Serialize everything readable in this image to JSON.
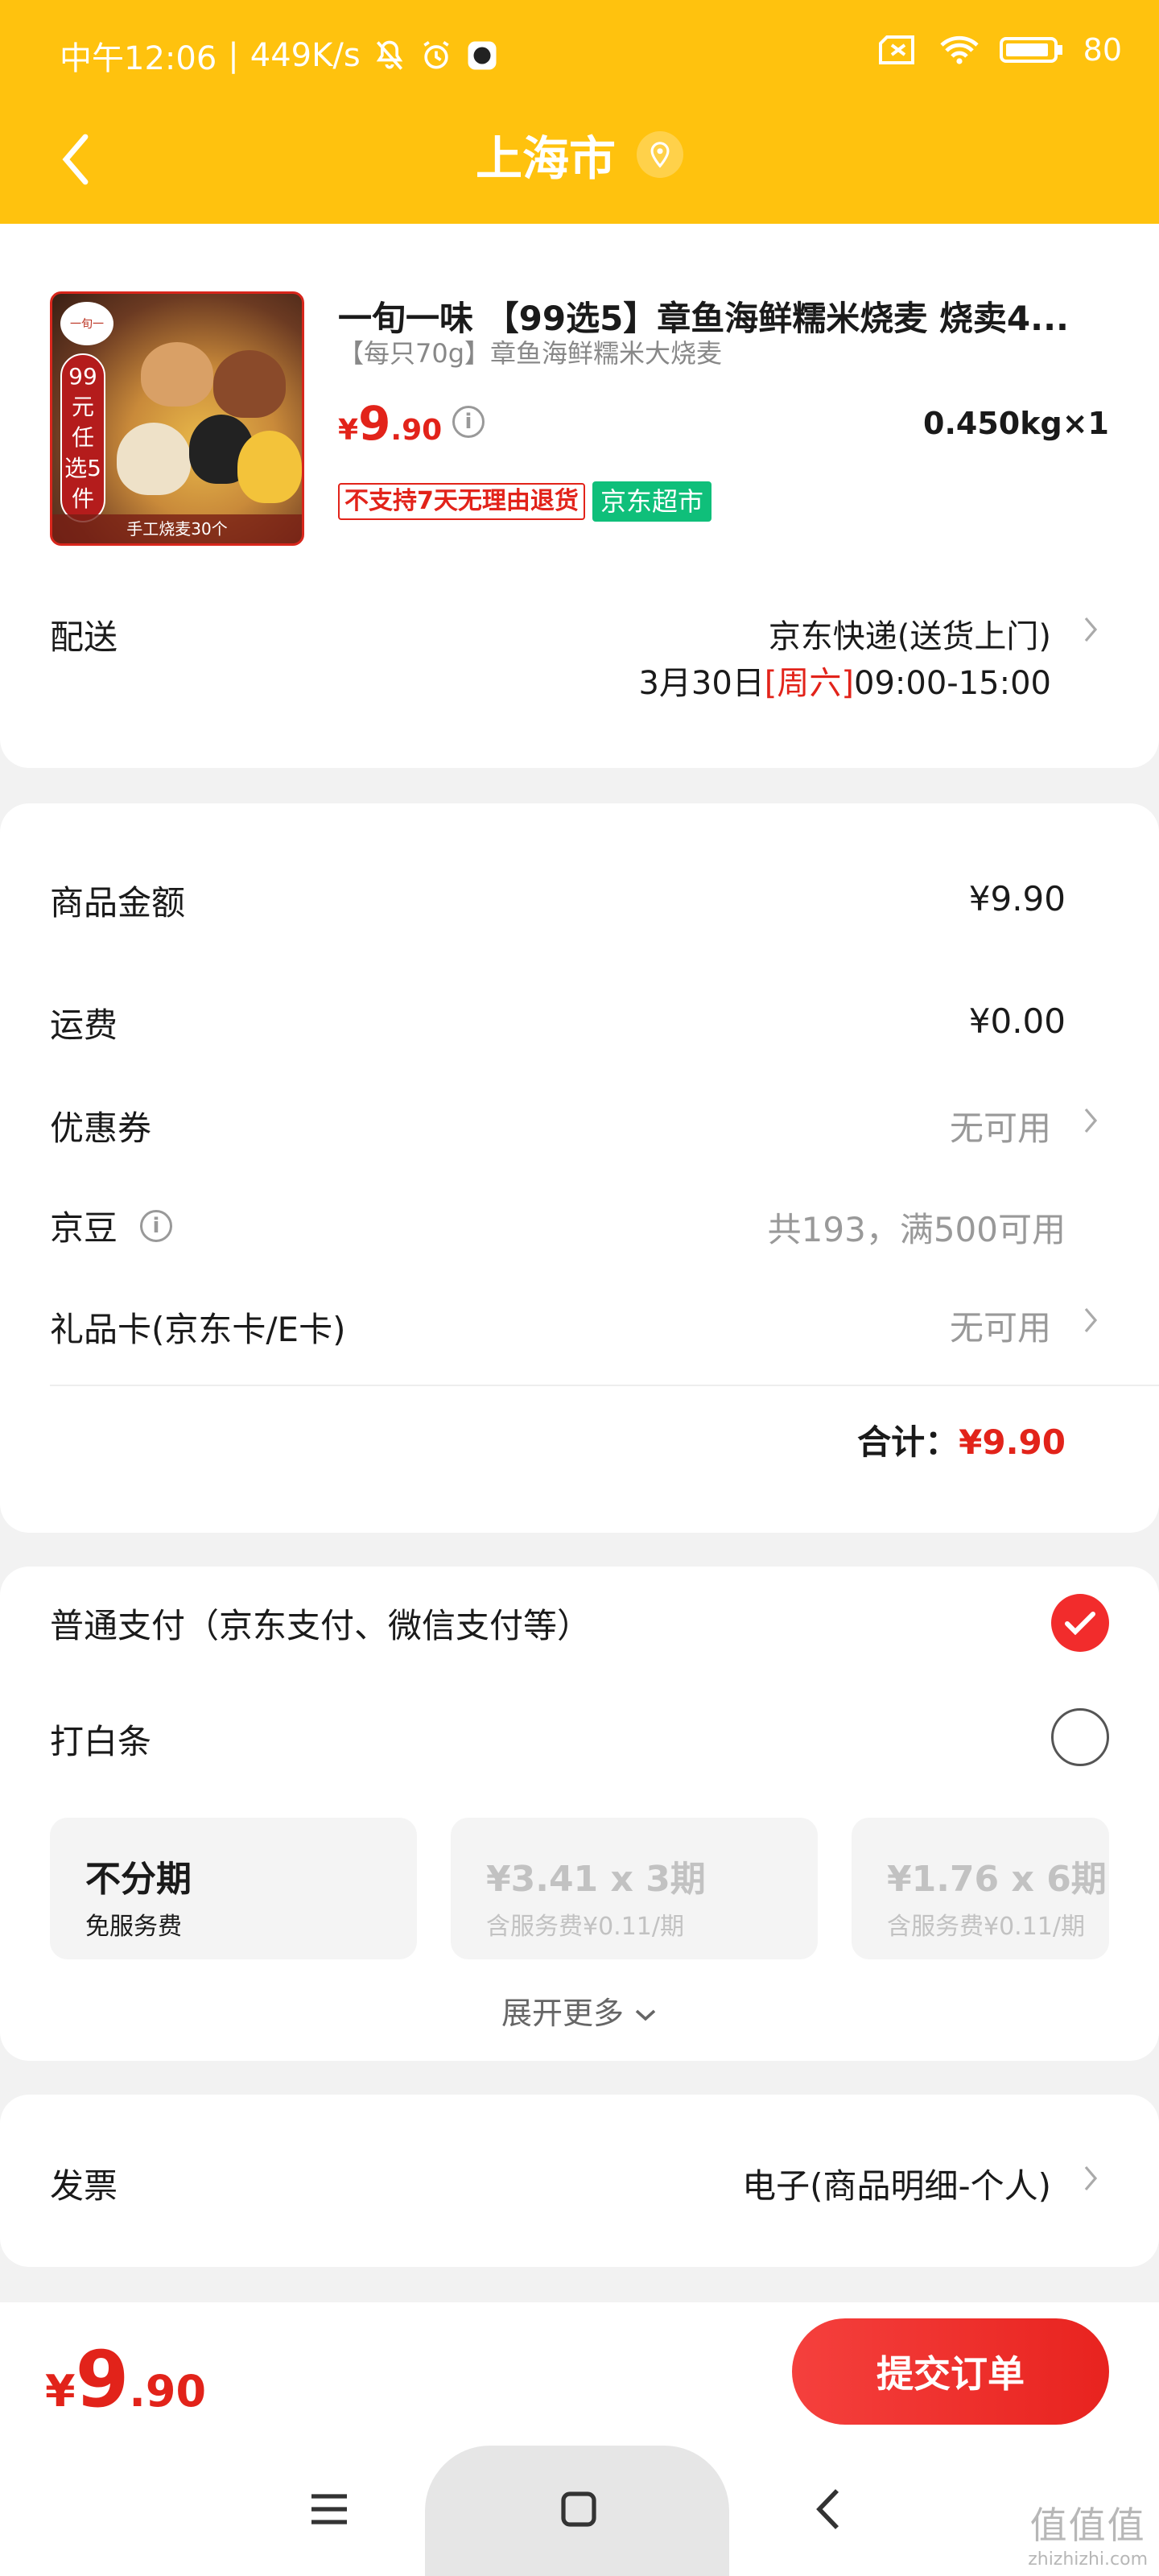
{
  "status_bar": {
    "time": "中午12:06",
    "speed": "449K/s",
    "battery": "80"
  },
  "nav": {
    "title": "上海市"
  },
  "product": {
    "title": "一旬一味 【99选5】章鱼海鲜糯米烧麦 烧卖4...",
    "subtitle": "【每只70g】章鱼海鲜糯米大烧麦",
    "price_symbol": "¥",
    "price_int": "9",
    "price_dec": ".90",
    "qty": "0.450kg×1",
    "tag_return": "不支持7天无理由退货",
    "tag_market": "京东超市",
    "image": {
      "logo": "一旬一",
      "badge": "99元任选5件",
      "footer": "手工烧麦30个"
    }
  },
  "delivery": {
    "label": "配送",
    "method": "京东快递(送货上门)",
    "date": "3月30日",
    "day": "[周六]",
    "time": "09:00-15:00"
  },
  "summary": {
    "rows": [
      {
        "label": "商品金额",
        "value": "¥9.90"
      },
      {
        "label": "运费",
        "value": "¥0.00"
      },
      {
        "label": "优惠券",
        "value": "无可用"
      },
      {
        "label": "京豆",
        "value": "共193，满500可用"
      },
      {
        "label": "礼品卡(京东卡/E卡)",
        "value": "无可用"
      }
    ],
    "total_label": "合计：",
    "total_value": "¥9.90"
  },
  "payment": {
    "normal": "普通支付（京东支付、微信支付等）",
    "baitiao": "打白条",
    "plans": [
      {
        "title": "不分期",
        "sub": "免服务费"
      },
      {
        "title": "¥3.41 x 3期",
        "sub": "含服务费¥0.11/期"
      },
      {
        "title": "¥1.76 x 6期",
        "sub": "含服务费¥0.11/期"
      }
    ],
    "expand": "展开更多"
  },
  "invoice": {
    "label": "发票",
    "value": "电子(商品明细-个人)"
  },
  "bottom": {
    "price_symbol": "¥",
    "price_int": "9",
    "price_dec": ".90",
    "submit": "提交订单"
  },
  "watermark": {
    "big": "值值值",
    "small": "zhizhizhi.com"
  },
  "colors": {
    "header": "#ffc20e",
    "price_red": "#e2231a",
    "market_green": "#0fbf7a"
  }
}
